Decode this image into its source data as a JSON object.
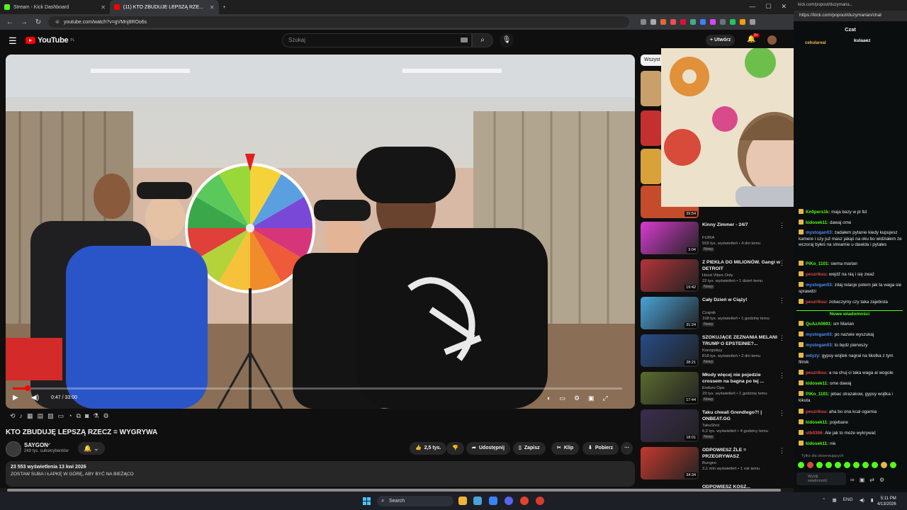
{
  "browser": {
    "tabs": [
      {
        "label": "Stream - Kick Dashboard",
        "active": false
      },
      {
        "label": "(11) KTO ZBUDUJE LEPSZĄ RZE...",
        "active": true
      }
    ],
    "url": "youtube.com/watch?v=gVMnj8ROo6s",
    "kick_url": "https://kick.com/popout/duzymarian/chat",
    "kick_tab": "kick.com/popout/duzymaria..."
  },
  "youtube": {
    "logo": "YouTube",
    "logo_region": "PL",
    "search_placeholder": "Szukaj",
    "create_label": "Utwórz",
    "notif_count": "9+",
    "video": {
      "title": "KTO ZBUDUJĘ LEPSZĄ RZECZ = WYGRYWA",
      "current_time": "0:47 / 33:00",
      "progress_fraction": 0.024
    },
    "channel": {
      "name": "SAYGON",
      "subs": "249 tys. subskrybentów"
    },
    "actions": {
      "likes": "2,5 tys.",
      "share": "Udostępnij",
      "save": "Zapisz",
      "clip": "Klip",
      "download": "Pobierz"
    },
    "description": {
      "stats": "23 553 wyświetlenia  13 kwi 2026",
      "line": "ZOSTAW SUBA I ŁAPKĘ W GÓRĘ, ABY BYĆ NA BIEŻĄCO"
    },
    "chip": "Wszyst",
    "recommendations": [
      {
        "title": "Kinny Zimmer - 24/7",
        "channel": "FURIA",
        "meta": "559 tys. wyświetleń • 4 dni temu",
        "badge": "Nowy",
        "duration": "3:04",
        "color": "#d83bd0"
      },
      {
        "title": "Z PIEKŁA DO MILIONÓW. Gangi w DETROIT",
        "channel": "Hood Vibes Only",
        "meta": "22 tys. wyświetleń • 1 dzień temu",
        "badge": "Nowy",
        "duration": "19:42",
        "color": "#b4343a"
      },
      {
        "title": "Cały Dzień w Ciąży!",
        "channel": "Czajnik",
        "meta": "168 tys. wyświetleń • 1 godzinę temu",
        "badge": "Nowy",
        "duration": "31:24",
        "color": "#4aa3d8"
      },
      {
        "title": "SZOKUJĄCE ZEZNANIA MELANI TRUMP O EPSTEINIE?...",
        "channel": "Konopskyy",
        "meta": "818 tys. wyświetleń • 2 dni temu",
        "badge": "Nowy",
        "duration": "28:21",
        "color": "#274c88"
      },
      {
        "title": "Młody więcej nie pojedzie crossem na bagna po tej ...",
        "channel": "Enduro Opa",
        "meta": "29 tys. wyświetleń • 1 godzinę temu",
        "badge": "Nowy",
        "duration": "17:44",
        "color": "#5b6b2e"
      },
      {
        "title": "Taku chwali Grendlego?! | ONBEAT.GG",
        "channel": "TakuShot",
        "meta": "6,2 tys. wyświetleń • 4 godziny temu",
        "badge": "Nowy",
        "duration": "18:01",
        "color": "#3a2d4e"
      },
      {
        "title": "ODPOWIESZ ŹLE = PRZEGRYWASZ",
        "channel": "Bungeo",
        "meta": "3,1 mln wyświetleń • 1 rok temu",
        "badge": "",
        "duration": "34:34",
        "color": "#c23a2e"
      }
    ],
    "partial_title": "ODPOWIESZ KOSZ..."
  },
  "kick": {
    "chat_title": "Czat",
    "pinned_user_1": "cebulareal",
    "pinned_user_2": "kulaaez",
    "new_messages": "Nowe wiadomości",
    "followers_only": "Tylko dla obserwujących",
    "input_placeholder": "Wyślij wiadomość",
    "messages": [
      {
        "user": "Kn0pers1k:",
        "text": "maja bazy w pl ltd",
        "color": "#53fc18"
      },
      {
        "user": "kidosek11:",
        "text": "dawaj ome",
        "color": "#53fc18"
      },
      {
        "user": "mystogan03:",
        "text": "zadałem pytanie kiedy kupujesz kamere i czy już masz jakąś na oku bo widziałem że wczoraj byłeś na streamie u dawida i pytałes",
        "color": "#4d8cf5"
      },
      {
        "user": "PiKo_1101:",
        "text": "siema marian",
        "color": "#53fc18"
      },
      {
        "user": "peszriksu:",
        "text": "wejdź na nią i się zważ",
        "color": "#e04848"
      },
      {
        "user": "mystogan03:",
        "text": "zdaj relacje potem jak ta waga sie sprawdzi",
        "color": "#4d8cf5"
      },
      {
        "user": "peszriksu:",
        "text": "zobaczymy czy taka zajebista",
        "color": "#e04848"
      },
      {
        "user": "QuAzA0691:",
        "text": "sm Marian",
        "color": "#53fc18"
      },
      {
        "user": "mystogan03:",
        "text": "po nazwie wyszukaj",
        "color": "#4d8cf5"
      },
      {
        "user": "mystogan03:",
        "text": "to będz pierwszy",
        "color": "#4d8cf5"
      },
      {
        "user": "wdyzy:",
        "text": "gypsy wojtek nagrał na tikotka z tym filmik",
        "color": "#4d8cf5"
      },
      {
        "user": "peszriksu:",
        "text": "a na chuj ci taka waga ai wogole",
        "color": "#e04848"
      },
      {
        "user": "kidosek11:",
        "text": "ome dawaj",
        "color": "#53fc18"
      },
      {
        "user": "PiKo_1101:",
        "text": "jebac strazakow, gypsy wojtka i kikuta",
        "color": "#53fc18"
      },
      {
        "user": "peszriksu:",
        "text": "aha bo ona kcal ogarnia",
        "color": "#e04848"
      },
      {
        "user": "kidosek11:",
        "text": "pojebane",
        "color": "#53fc18"
      },
      {
        "user": "stb0306:",
        "text": "Ale jak to może wykrywać",
        "color": "#e04848"
      },
      {
        "user": "kidosek11:",
        "text": "nie",
        "color": "#53fc18"
      }
    ]
  },
  "taskbar": {
    "search": "Search",
    "lang": "ENG",
    "time": "5:11 PM",
    "date": "4/13/2026"
  },
  "colors": {
    "yt_red": "#ff0000",
    "kick_green": "#53fc18",
    "mention_blue": "#4d8cf5"
  }
}
